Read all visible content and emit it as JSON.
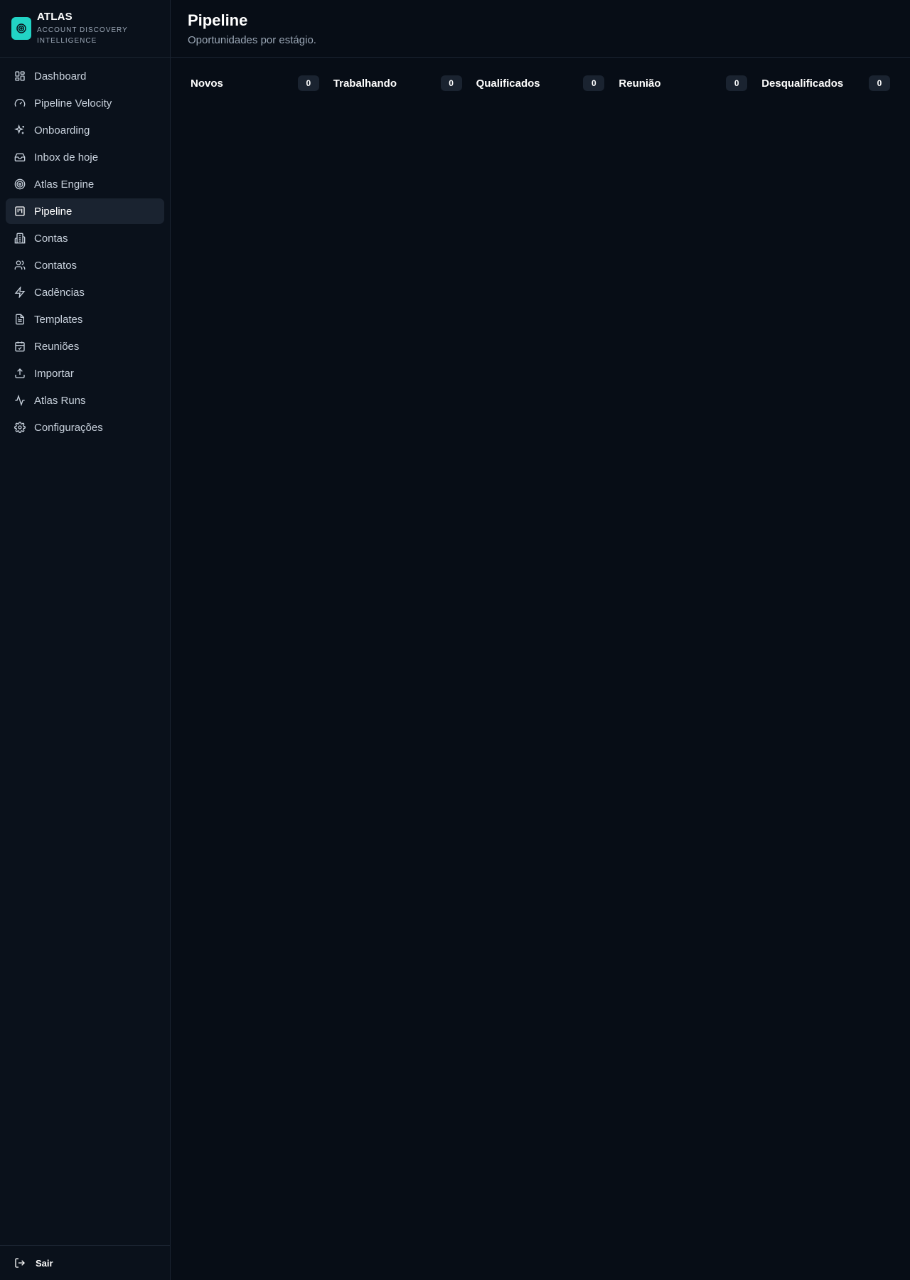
{
  "brand": {
    "name": "ATLAS",
    "tagline": "ACCOUNT DISCOVERY INTELLIGENCE",
    "accent": "#22d3c5"
  },
  "sidebar": {
    "items": [
      {
        "label": "Dashboard",
        "icon": "grid-icon"
      },
      {
        "label": "Pipeline Velocity",
        "icon": "gauge-icon"
      },
      {
        "label": "Onboarding",
        "icon": "sparkles-icon"
      },
      {
        "label": "Inbox de hoje",
        "icon": "inbox-icon"
      },
      {
        "label": "Atlas Engine",
        "icon": "target-icon"
      },
      {
        "label": "Pipeline",
        "icon": "kanban-icon",
        "active": true
      },
      {
        "label": "Contas",
        "icon": "building-icon"
      },
      {
        "label": "Contatos",
        "icon": "users-icon"
      },
      {
        "label": "Cadências",
        "icon": "zap-icon"
      },
      {
        "label": "Templates",
        "icon": "file-text-icon"
      },
      {
        "label": "Reuniões",
        "icon": "calendar-check-icon"
      },
      {
        "label": "Importar",
        "icon": "upload-icon"
      },
      {
        "label": "Atlas Runs",
        "icon": "activity-icon"
      },
      {
        "label": "Configurações",
        "icon": "settings-icon"
      }
    ],
    "logout_label": "Sair"
  },
  "header": {
    "title": "Pipeline",
    "subtitle": "Oportunidades por estágio."
  },
  "columns": [
    {
      "title": "Novos",
      "count": "0"
    },
    {
      "title": "Trabalhando",
      "count": "0"
    },
    {
      "title": "Qualificados",
      "count": "0"
    },
    {
      "title": "Reunião",
      "count": "0"
    },
    {
      "title": "Desqualificados",
      "count": "0"
    }
  ]
}
